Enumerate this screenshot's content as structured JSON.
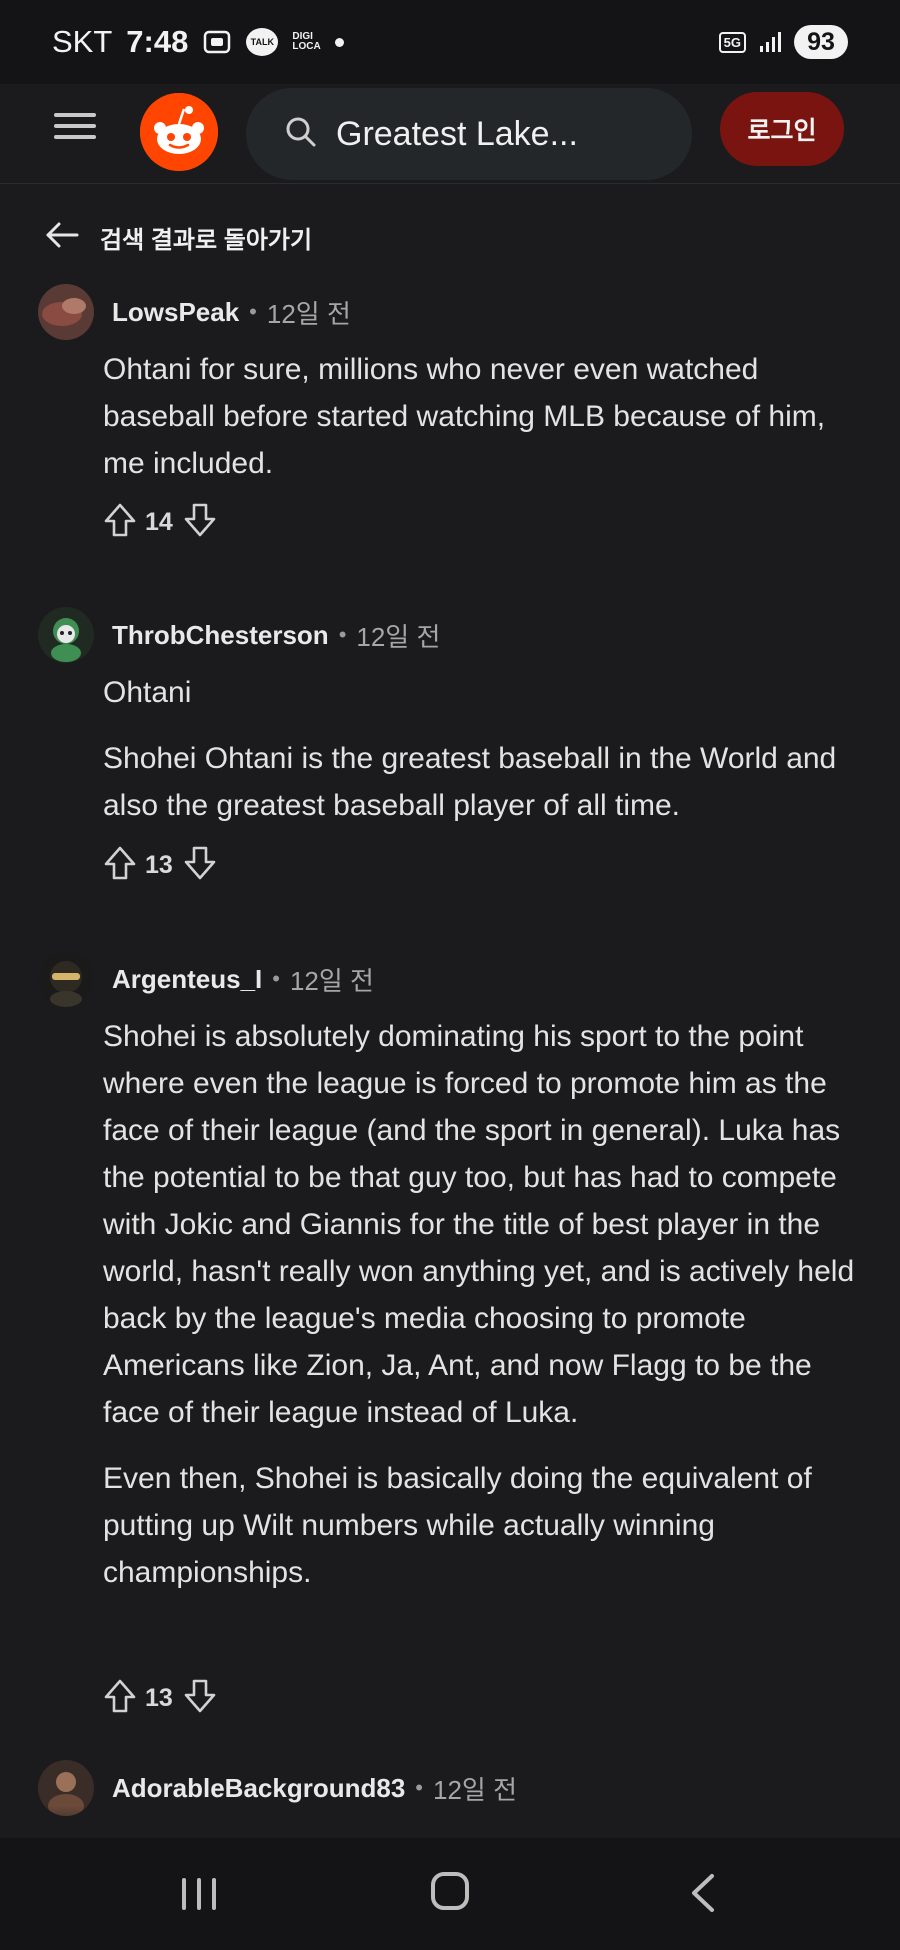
{
  "status_bar": {
    "carrier": "SKT",
    "time": "7:48",
    "talk_label": "TALK",
    "digi_line1": "DIGI",
    "digi_line2": "LOCA",
    "network": "5G",
    "battery": "93"
  },
  "header": {
    "search_text": "Greatest Lake...",
    "login_label": "로그인"
  },
  "back": {
    "label": "검색 결과로 돌아가기"
  },
  "comments": [
    {
      "author": "LowsPeak",
      "separator": "•",
      "time": "12일 전",
      "paragraphs": [
        "Ohtani for sure, millions who never even watched baseball before started watching MLB because of him, me included."
      ],
      "votes": "14"
    },
    {
      "author": "ThrobChesterson",
      "separator": "•",
      "time": "12일 전",
      "paragraphs": [
        "Ohtani",
        "Shohei Ohtani is the greatest baseball in the World and also the greatest baseball player of all time."
      ],
      "votes": "13"
    },
    {
      "author": "Argenteus_I",
      "separator": "•",
      "time": "12일 전",
      "paragraphs": [
        "Shohei is absolutely dominating his sport to the point where even the league is forced to promote him as the face of their league (and the sport in general). Luka has the potential to be that guy too, but has had to compete with Jokic and Giannis for the title of best player in the world, hasn't really won anything yet, and is actively held back by the league's media choosing to promote Americans like Zion, Ja, Ant, and now Flagg to be the face of their league instead of Luka.",
        "Even then, Shohei is basically doing the equivalent of putting up Wilt numbers while actually winning championships."
      ],
      "votes": "13"
    },
    {
      "author": "AdorableBackground83",
      "separator": "•",
      "time": "12일 전",
      "paragraphs": []
    }
  ],
  "colors": {
    "background": "#1b1b1d",
    "brand": "#ff4500",
    "login_button": "#7a1410"
  },
  "icons": [
    "menu-icon",
    "reddit-logo",
    "search-icon",
    "back-arrow-icon",
    "upvote-icon",
    "downvote-icon",
    "recents-icon",
    "home-icon",
    "nav-back-icon"
  ]
}
